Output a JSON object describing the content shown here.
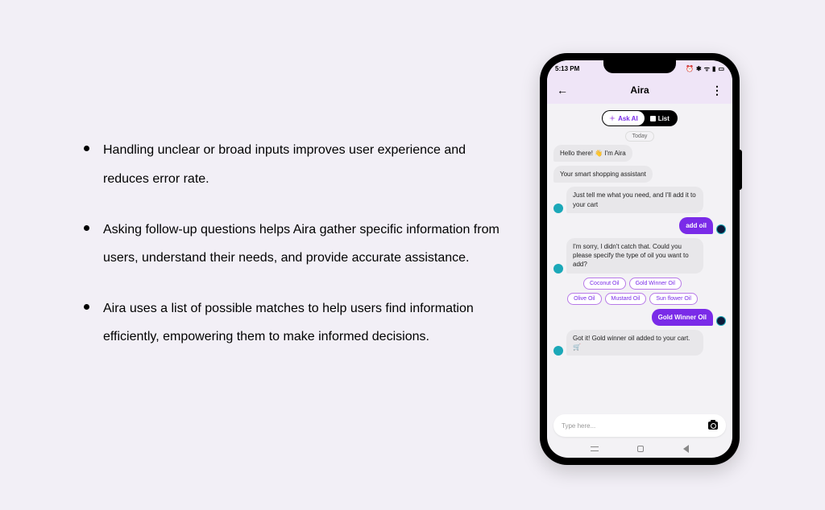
{
  "bullets": [
    "Handling unclear or broad inputs improves user experience and reduces error rate.",
    "Asking follow-up questions helps Aira gather specific information from users, understand their needs, and provide accurate assistance.",
    "Aira uses a list of possible matches to help users find information efficiently, empowering them to make informed decisions."
  ],
  "phone": {
    "status_time": "5:13 PM",
    "status_icons": [
      "⏰",
      "✱",
      "📶",
      "🔋"
    ],
    "app_title": "Aira",
    "segmented": {
      "ask_label": "Ask AI",
      "list_label": "List"
    },
    "date_pill": "Today",
    "messages": [
      {
        "role": "ai",
        "text": "Hello there! 👋 I'm Aira"
      },
      {
        "role": "ai",
        "text": "Your smart shopping assistant"
      },
      {
        "role": "ai",
        "text": "Just tell me what you need, and  I'll add it to your cart"
      },
      {
        "role": "user",
        "text": "add oil"
      },
      {
        "role": "ai",
        "text": "I'm sorry, I didn't catch that. Could you please specify the type of oil you want to add?"
      }
    ],
    "chips": [
      "Coconut Oil",
      "Gold Winner Oil",
      "Olive Oil",
      "Mustard Oil",
      "Sun flower Oil"
    ],
    "messages2": [
      {
        "role": "user",
        "text": "Gold Winner Oil"
      },
      {
        "role": "ai",
        "text": "Got it! Gold winner oil added to your cart.🛒"
      }
    ],
    "input_placeholder": "Type here..."
  }
}
